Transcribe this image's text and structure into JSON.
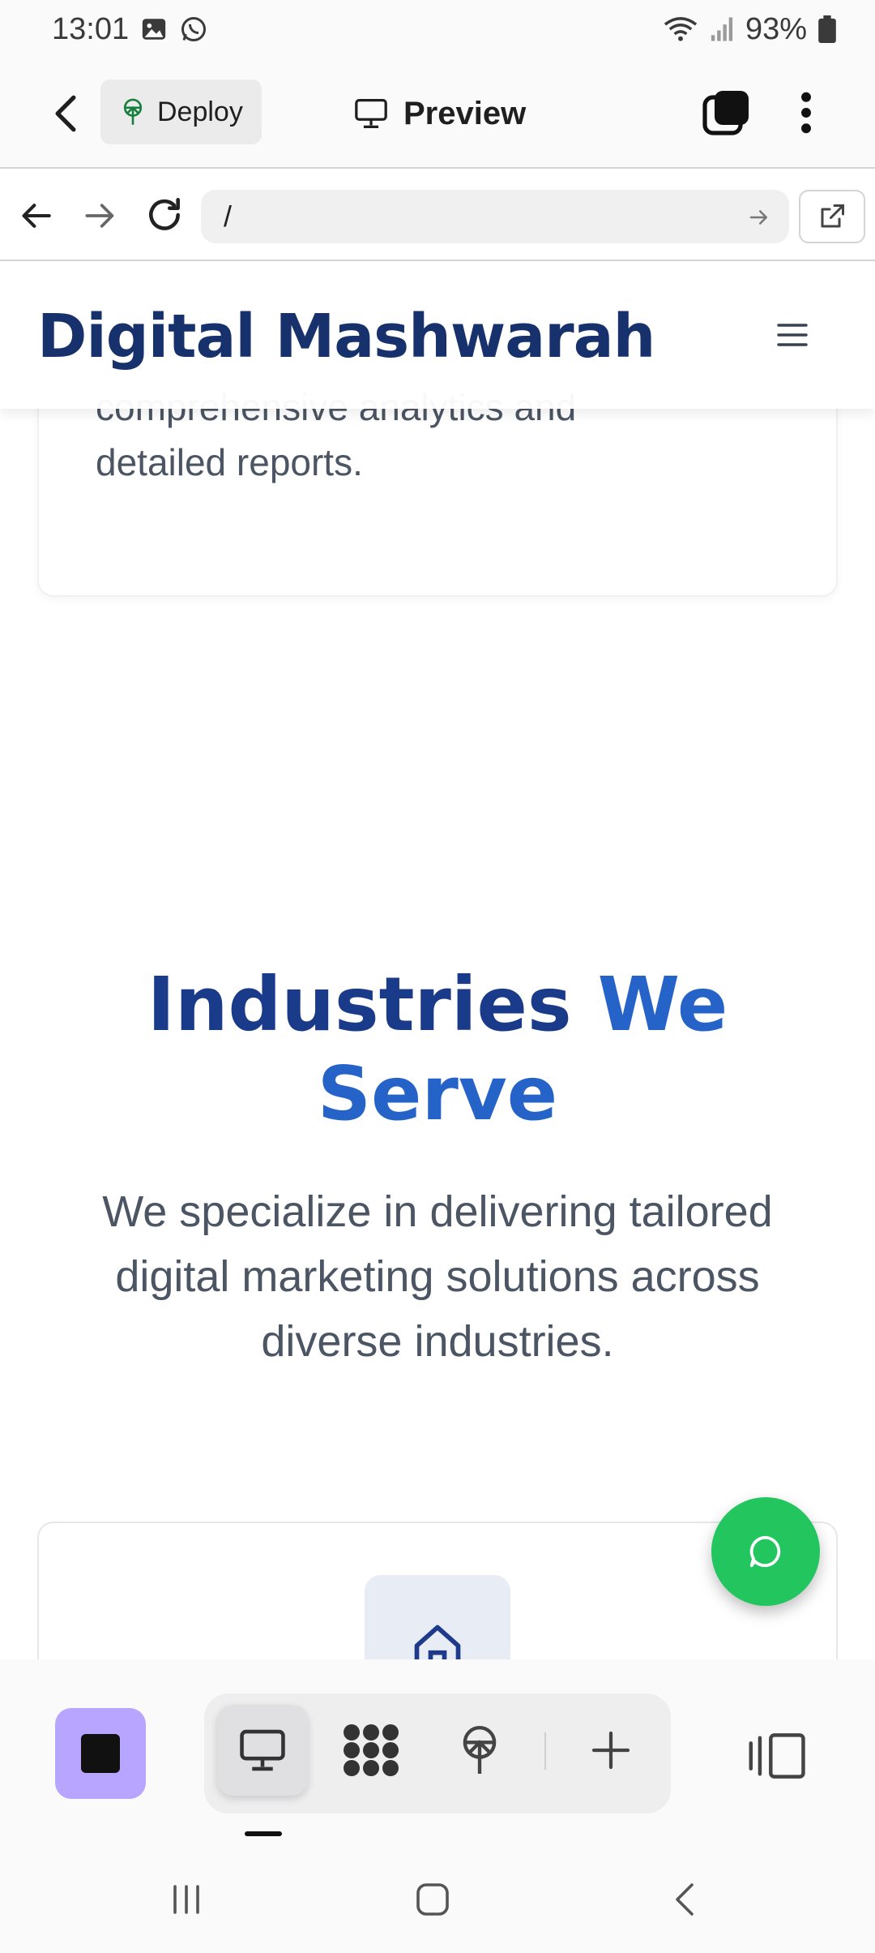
{
  "status_bar": {
    "time": "13:01",
    "battery": "93%",
    "icons": [
      "gallery-icon",
      "whatsapp-icon",
      "wifi-icon",
      "signal-icon",
      "battery-icon"
    ]
  },
  "app_header": {
    "deploy_label": "Deploy",
    "preview_label": "Preview"
  },
  "browser": {
    "url": "/"
  },
  "site": {
    "brand": "Digital Mashwarah",
    "prev_card_text": "comprehensive analytics and detailed reports.",
    "section_title_part1": "Industries",
    "section_title_part2": "We",
    "section_title_part3": "Serve",
    "section_subtitle": "We specialize in delivering tailored digital marketing solutions across diverse industries."
  },
  "colors": {
    "brand_navy": "#16316b",
    "title_blue": "#2563c8",
    "chat_green": "#22c55e",
    "stop_purple": "#b7a5ff"
  }
}
